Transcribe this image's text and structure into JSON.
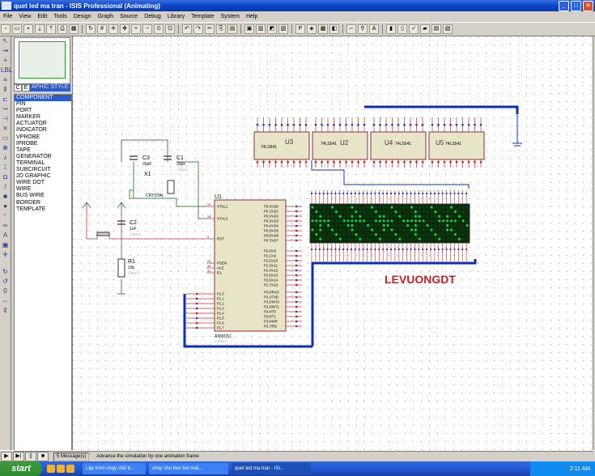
{
  "window": {
    "title": "quet led ma tran - ISIS Professional (Animating)",
    "buttons": [
      "_",
      "□",
      "×"
    ]
  },
  "menu": [
    "File",
    "View",
    "Edit",
    "Tools",
    "Design",
    "Graph",
    "Source",
    "Debug",
    "Library",
    "Template",
    "System",
    "Help"
  ],
  "sidebar": {
    "tabs": [
      "C",
      "E"
    ],
    "tab_title": "APHIC STYLE",
    "items": [
      "COMPONENT",
      "PIN",
      "PORT",
      "MARKER",
      "ACTUATOR",
      "INDICATOR",
      "VPROBE",
      "IPROBE",
      "TAPE",
      "GENERATOR",
      "TERMINAL",
      "SUBCIRCUIT",
      "2D GRAPHIC",
      "WIRE DOT",
      "WIRE",
      "BUS WIRE",
      "BORDER",
      "TEMPLATE"
    ],
    "selected": 0
  },
  "schematic": {
    "mcu": {
      "ref": "U1",
      "part": "AT89C51",
      "text": "<TEXT>",
      "left_pins": [
        {
          "name": "XTAL1",
          "num": "19"
        },
        {
          "name": "XTAL2",
          "num": "18"
        },
        {
          "name": "RST",
          "num": "9"
        },
        {
          "name": "PSEN",
          "num": "29"
        },
        {
          "name": "ALE",
          "num": "30"
        },
        {
          "name": "EA",
          "num": "31"
        }
      ],
      "p0": [
        "P0.0/AD0",
        "P0.1/AD1",
        "P0.2/AD2",
        "P0.3/AD3",
        "P0.4/AD4",
        "P0.5/AD5",
        "P0.6/AD6",
        "P0.7/AD7"
      ],
      "p2": [
        "P2.0/A8",
        "P2.1/A9",
        "P2.2/A10",
        "P2.3/A11",
        "P2.4/A12",
        "P2.5/A13",
        "P2.6/A14",
        "P2.7/A15"
      ],
      "p3": [
        "P3.0/RXD",
        "P3.1/TXD",
        "P3.2/INT0",
        "P3.3/INT1",
        "P3.4/T0",
        "P3.5/T1",
        "P3.6/WR",
        "P3.7/RD"
      ],
      "p1": [
        "P1.0",
        "P1.1",
        "P1.2",
        "P1.3",
        "P1.4",
        "P1.5",
        "P1.6",
        "P1.7"
      ]
    },
    "buffers": [
      {
        "ref": "U3",
        "part": "74LS541"
      },
      {
        "ref": "U2",
        "part": "74LS541"
      },
      {
        "ref": "U4",
        "part": "74LS541"
      },
      {
        "ref": "U5",
        "part": "74LS541"
      }
    ],
    "c3": {
      "ref": "C3",
      "value": "33pF"
    },
    "c1": {
      "ref": "C1",
      "value": "33pF"
    },
    "x1": {
      "ref": "X1",
      "value": "CRYSTAL"
    },
    "c2": {
      "ref": "C2",
      "value": "1uF"
    },
    "r1": {
      "ref": "R1",
      "value": "10k"
    },
    "text_tag": "<TEXT>",
    "label": "LEVUONGDT",
    "led_matrix": {
      "rows": 8,
      "cols": 40
    }
  },
  "status": {
    "play_controls": [
      "▶",
      "▶|",
      "||",
      "■"
    ],
    "messages": "5 Message(s)",
    "hint": "Advance the simulation by one animation frame"
  },
  "taskbar": {
    "start": "start",
    "tasks": [
      "Lập trình chạy chữ tr...",
      "chay chu tren led mat...",
      "quet led ma tran - ISI..."
    ],
    "active_task": 2,
    "clock": "2:11 AM"
  },
  "colors": {
    "pcb_red": "#c83232",
    "wire_blue": "#0b2fb4",
    "led_on": "#10d040",
    "led_off": "#0a3a10",
    "chip_fill": "#e8e4c8"
  }
}
